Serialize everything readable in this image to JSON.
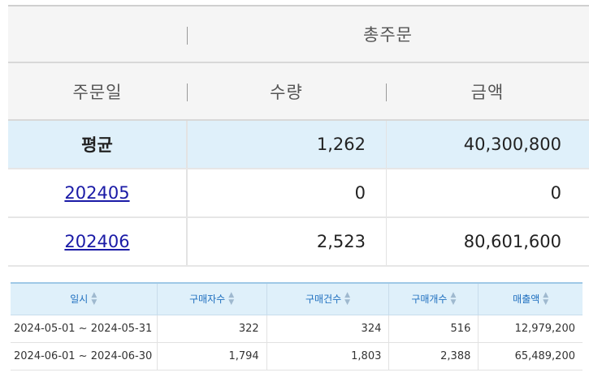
{
  "summary": {
    "group_header": "총주문",
    "columns": {
      "date": "주문일",
      "qty": "수량",
      "amount": "금액"
    },
    "avg": {
      "label": "평균",
      "qty": "1,262",
      "amount": "40,300,800"
    },
    "rows": [
      {
        "date": "202405",
        "qty": "0",
        "amount": "0"
      },
      {
        "date": "202406",
        "qty": "2,523",
        "amount": "80,601,600"
      }
    ]
  },
  "detail": {
    "headers": [
      "일시",
      "구매자수",
      "구매건수",
      "구매개수",
      "매출액"
    ],
    "sort_icon": "sort-updown-icon",
    "rows": [
      [
        "2024-05-01 ~ 2024-05-31",
        "322",
        "324",
        "516",
        "12,979,200"
      ],
      [
        "2024-06-01 ~ 2024-06-30",
        "1,794",
        "1,803",
        "2,388",
        "65,489,200"
      ]
    ]
  }
}
